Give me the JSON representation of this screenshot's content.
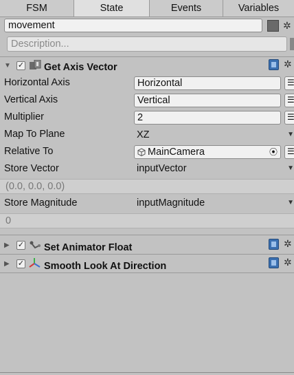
{
  "tabs": [
    {
      "label": "FSM",
      "active": false
    },
    {
      "label": "State",
      "active": true
    },
    {
      "label": "Events",
      "active": false
    },
    {
      "label": "Variables",
      "active": false
    }
  ],
  "state": {
    "name": "movement",
    "description_placeholder": "Description...",
    "color": "#6a6a6a"
  },
  "actions": [
    {
      "title": "Get Axis Vector",
      "enabled": true,
      "expanded": true,
      "icon": "get-axis-vector-icon",
      "fields": {
        "horizontal_axis": {
          "label": "Horizontal Axis",
          "value": "Horizontal"
        },
        "vertical_axis": {
          "label": "Vertical Axis",
          "value": "Vertical"
        },
        "multiplier": {
          "label": "Multiplier",
          "value": "2"
        },
        "map_to_plane": {
          "label": "Map To Plane",
          "value": "XZ"
        },
        "relative_to": {
          "label": "Relative To",
          "value": "MainCamera"
        },
        "store_vector": {
          "label": "Store Vector",
          "value": "inputVector",
          "readout": "(0.0, 0.0, 0.0)"
        },
        "store_magnitude": {
          "label": "Store Magnitude",
          "value": "inputMagnitude",
          "readout": "0"
        }
      }
    },
    {
      "title": "Set Animator Float",
      "enabled": true,
      "expanded": false,
      "icon": "animator-icon"
    },
    {
      "title": "Smooth Look At Direction",
      "enabled": true,
      "expanded": false,
      "icon": "transform-axes-icon"
    }
  ],
  "colors": {
    "panel": "#c2c2c2",
    "field": "#f1f1f1",
    "help": "#3a6fb0"
  }
}
